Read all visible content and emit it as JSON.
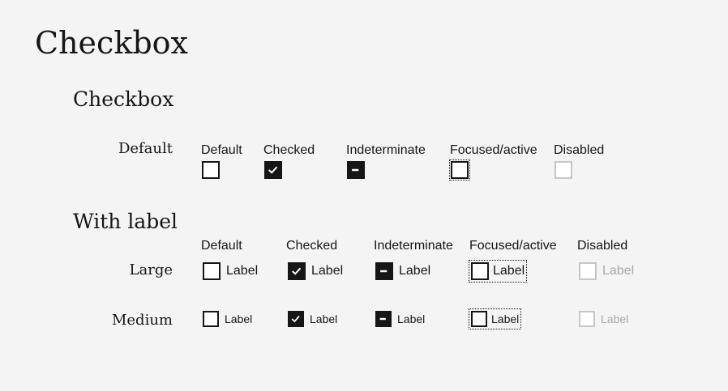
{
  "page": {
    "title": "Checkbox"
  },
  "sections": {
    "basic": {
      "title": "Checkbox",
      "row_label": "Default",
      "states": [
        "Default",
        "Checked",
        "Indeterminate",
        "Focused/active",
        "Disabled"
      ]
    },
    "with_label": {
      "title": "With label",
      "states": [
        "Default",
        "Checked",
        "Indeterminate",
        "Focused/active",
        "Disabled"
      ],
      "rows": [
        {
          "size": "Large",
          "label": "Label"
        },
        {
          "size": "Medium",
          "label": "Label"
        }
      ]
    }
  },
  "icons": {
    "check": "checkmark-icon",
    "indeterminate": "minus-icon"
  },
  "colors": {
    "background": "#f4f4f4",
    "ink": "#161616",
    "disabled": "#c6c6c6",
    "disabled_text": "#a8a8a8"
  }
}
